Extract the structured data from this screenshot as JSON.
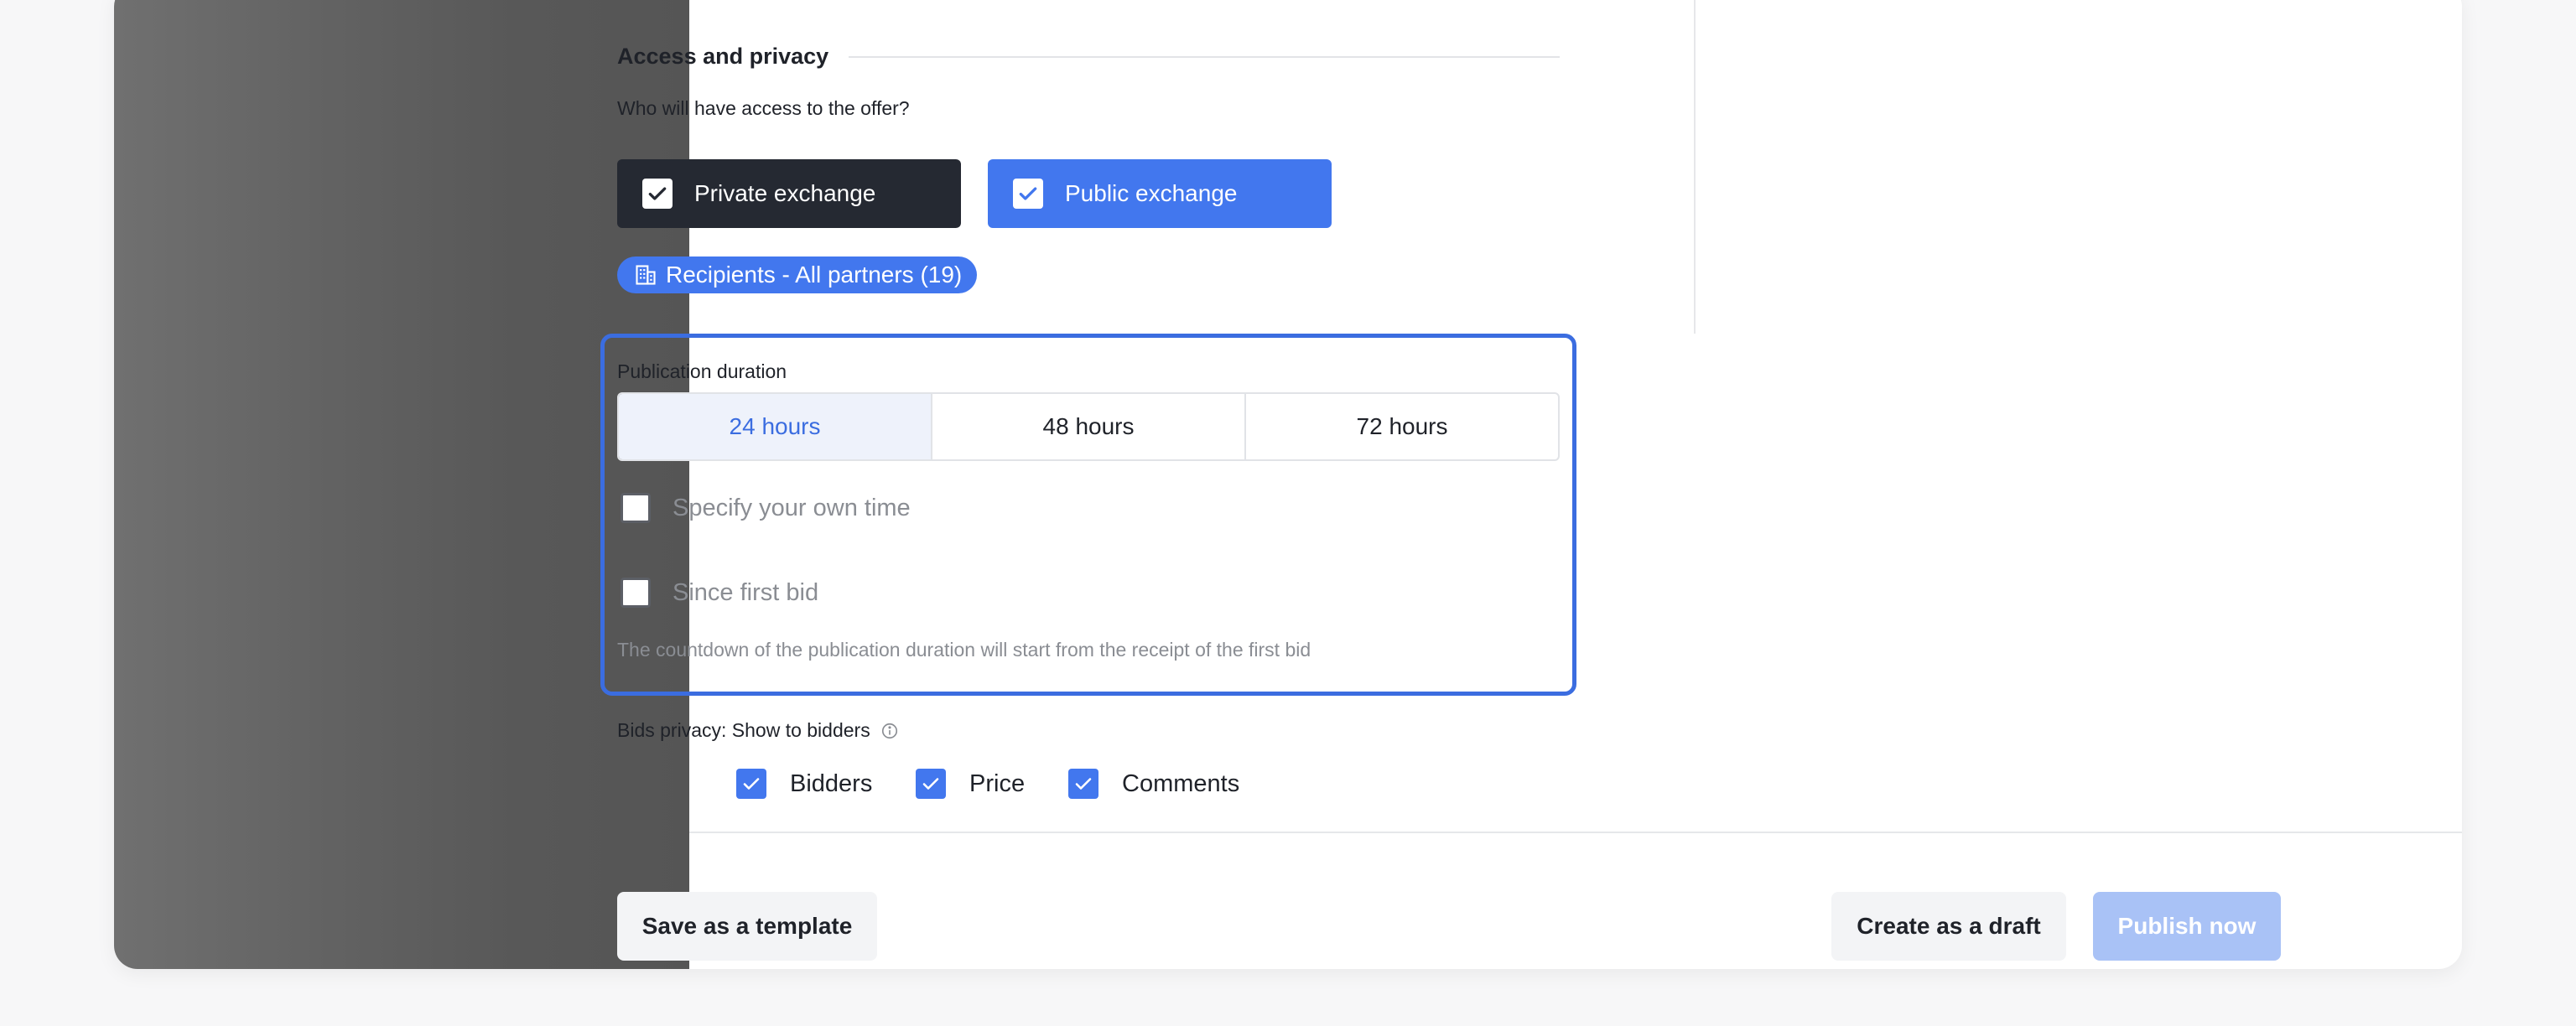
{
  "access": {
    "section_title": "Access and privacy",
    "question": "Who will have access to the offer?",
    "private_label": "Private exchange",
    "public_label": "Public exchange",
    "recipients_chip": "Recipients - All partners (19)"
  },
  "duration": {
    "label": "Publication duration",
    "options": [
      "24 hours",
      "48 hours",
      "72 hours"
    ],
    "selected": "24 hours",
    "own_time_label": "Specify your own time",
    "first_bid_label": "Since first bid",
    "hint": "The countdown of the publication duration will start from the receipt of the first bid"
  },
  "bids_privacy": {
    "label": "Bids privacy: Show to bidders",
    "options": [
      "Bidders",
      "Price",
      "Comments"
    ]
  },
  "footer": {
    "save_template": "Save as a template",
    "create_draft": "Create as a draft",
    "publish_now": "Publish now"
  },
  "colors": {
    "accent": "#4277ee",
    "dark": "#252932",
    "highlight_border": "#3b6de0",
    "publish_disabled": "#a9c2f6"
  },
  "icons": {
    "check": "check-icon",
    "building": "building-icon",
    "info": "info-icon"
  }
}
